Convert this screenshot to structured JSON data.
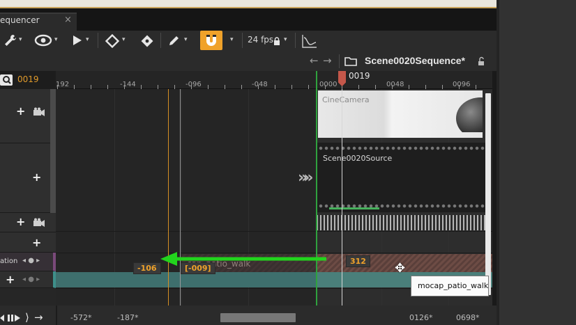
{
  "tab": {
    "label": "equencer",
    "close": "×"
  },
  "toolbar": {
    "fps_label": "24 fps",
    "caret": "▾"
  },
  "nav": {
    "sequence_name": "Scene0020Sequence*",
    "back_arrow": "←",
    "forward_arrow": "→"
  },
  "outliner": {
    "current_frame": "0019",
    "rows": [
      {
        "name": "camera-row"
      },
      {
        "name": "shot-row"
      },
      {
        "name": "camera-cut-row"
      },
      {
        "name": "folder-row"
      },
      {
        "name": "animation-row",
        "label": "ation"
      },
      {
        "name": "transform-row"
      }
    ]
  },
  "ruler": {
    "labels": [
      "192",
      "-144",
      "-096",
      "-048",
      "0000",
      "0048",
      "0096"
    ],
    "playhead_label": "0019"
  },
  "tracks": {
    "camera_label": "CineCamera",
    "shot_label": "Scene0020Source",
    "animation_ghost_label": "cap_patio_walk",
    "badge_left": "-106",
    "badge_mid": "[-009]",
    "badge_right": "312"
  },
  "tooltip": {
    "text": "mocap_patio_walk"
  },
  "bottom": {
    "labels": [
      "-572*",
      "-187*",
      "0126*",
      "0698*"
    ]
  },
  "colors": {
    "accent": "#f0a22a",
    "playhead": "#c4574a",
    "range_start": "#2fa23e",
    "drag_arrow": "#22d41d"
  }
}
